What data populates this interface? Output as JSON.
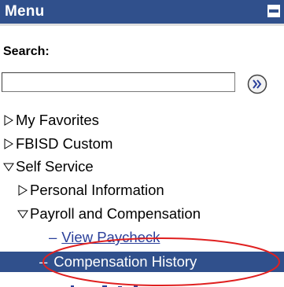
{
  "menu": {
    "title": "Menu",
    "collapse_icon": "minus-icon"
  },
  "search": {
    "label": "Search:",
    "value": "",
    "placeholder": "",
    "go_icon": "double-chevron-right-icon"
  },
  "tree": {
    "items": [
      {
        "label": "My Favorites",
        "state": "collapsed"
      },
      {
        "label": "FBISD Custom",
        "state": "collapsed"
      },
      {
        "label": "Self Service",
        "state": "expanded"
      },
      {
        "label": "Personal Information",
        "state": "collapsed"
      },
      {
        "label": "Payroll and Compensation",
        "state": "expanded"
      },
      {
        "label": "View Paycheck",
        "state": "leaf-link"
      },
      {
        "label": "Compensation History",
        "state": "leaf-selected"
      }
    ],
    "leaf_prefix": "–"
  },
  "colors": {
    "header_bg": "#30508c",
    "selected_bg": "#30508c",
    "link": "#2a3f9a",
    "annotation": "#e02020"
  }
}
